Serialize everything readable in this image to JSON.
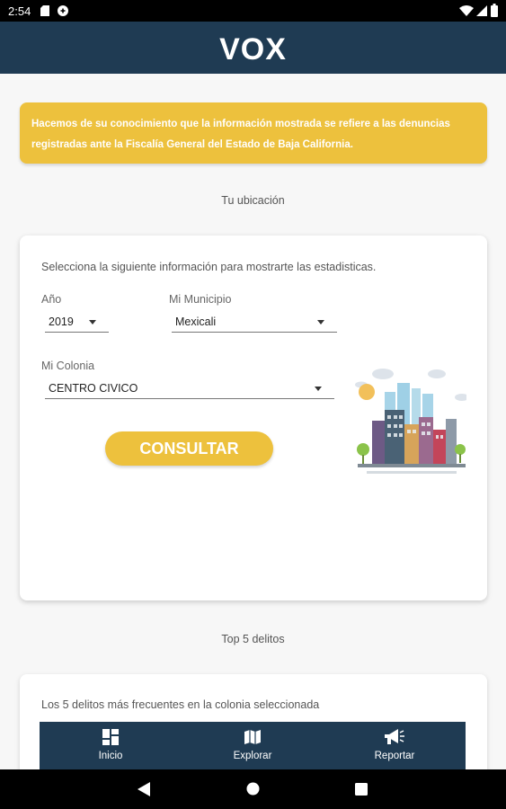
{
  "status_bar": {
    "time": "2:54",
    "icons": [
      "sd-card-icon",
      "data-saver-icon",
      "wifi-icon",
      "signal-icon",
      "battery-icon"
    ]
  },
  "app_bar": {
    "title": "VOX"
  },
  "notice": {
    "text": "Hacemos de su conocimiento que la información mostrada se refiere a las denuncias registradas ante la Fiscalía General del Estado de Baja California."
  },
  "location": {
    "section_title": "Tu ubicación",
    "intro": "Selecciona la siguiente información para mostrarte las estadisticas.",
    "year": {
      "label": "Año",
      "value": "2019"
    },
    "municipality": {
      "label": "Mi Municipio",
      "value": "Mexicali"
    },
    "colony": {
      "label": "Mi Colonia",
      "value": "CENTRO CIVICO"
    },
    "submit_label": "CONSULTAR"
  },
  "top_crimes": {
    "section_title": "Top 5 delitos",
    "intro": "Los 5 delitos más frecuentes en la colonia seleccionada"
  },
  "bottom_nav": {
    "items": [
      {
        "label": "Inicio",
        "icon": "dashboard-icon"
      },
      {
        "label": "Explorar",
        "icon": "map-icon"
      },
      {
        "label": "Reportar",
        "icon": "megaphone-icon"
      }
    ]
  },
  "colors": {
    "primary": "#1f3b53",
    "accent": "#edc13d",
    "background": "#f7f7f7"
  }
}
